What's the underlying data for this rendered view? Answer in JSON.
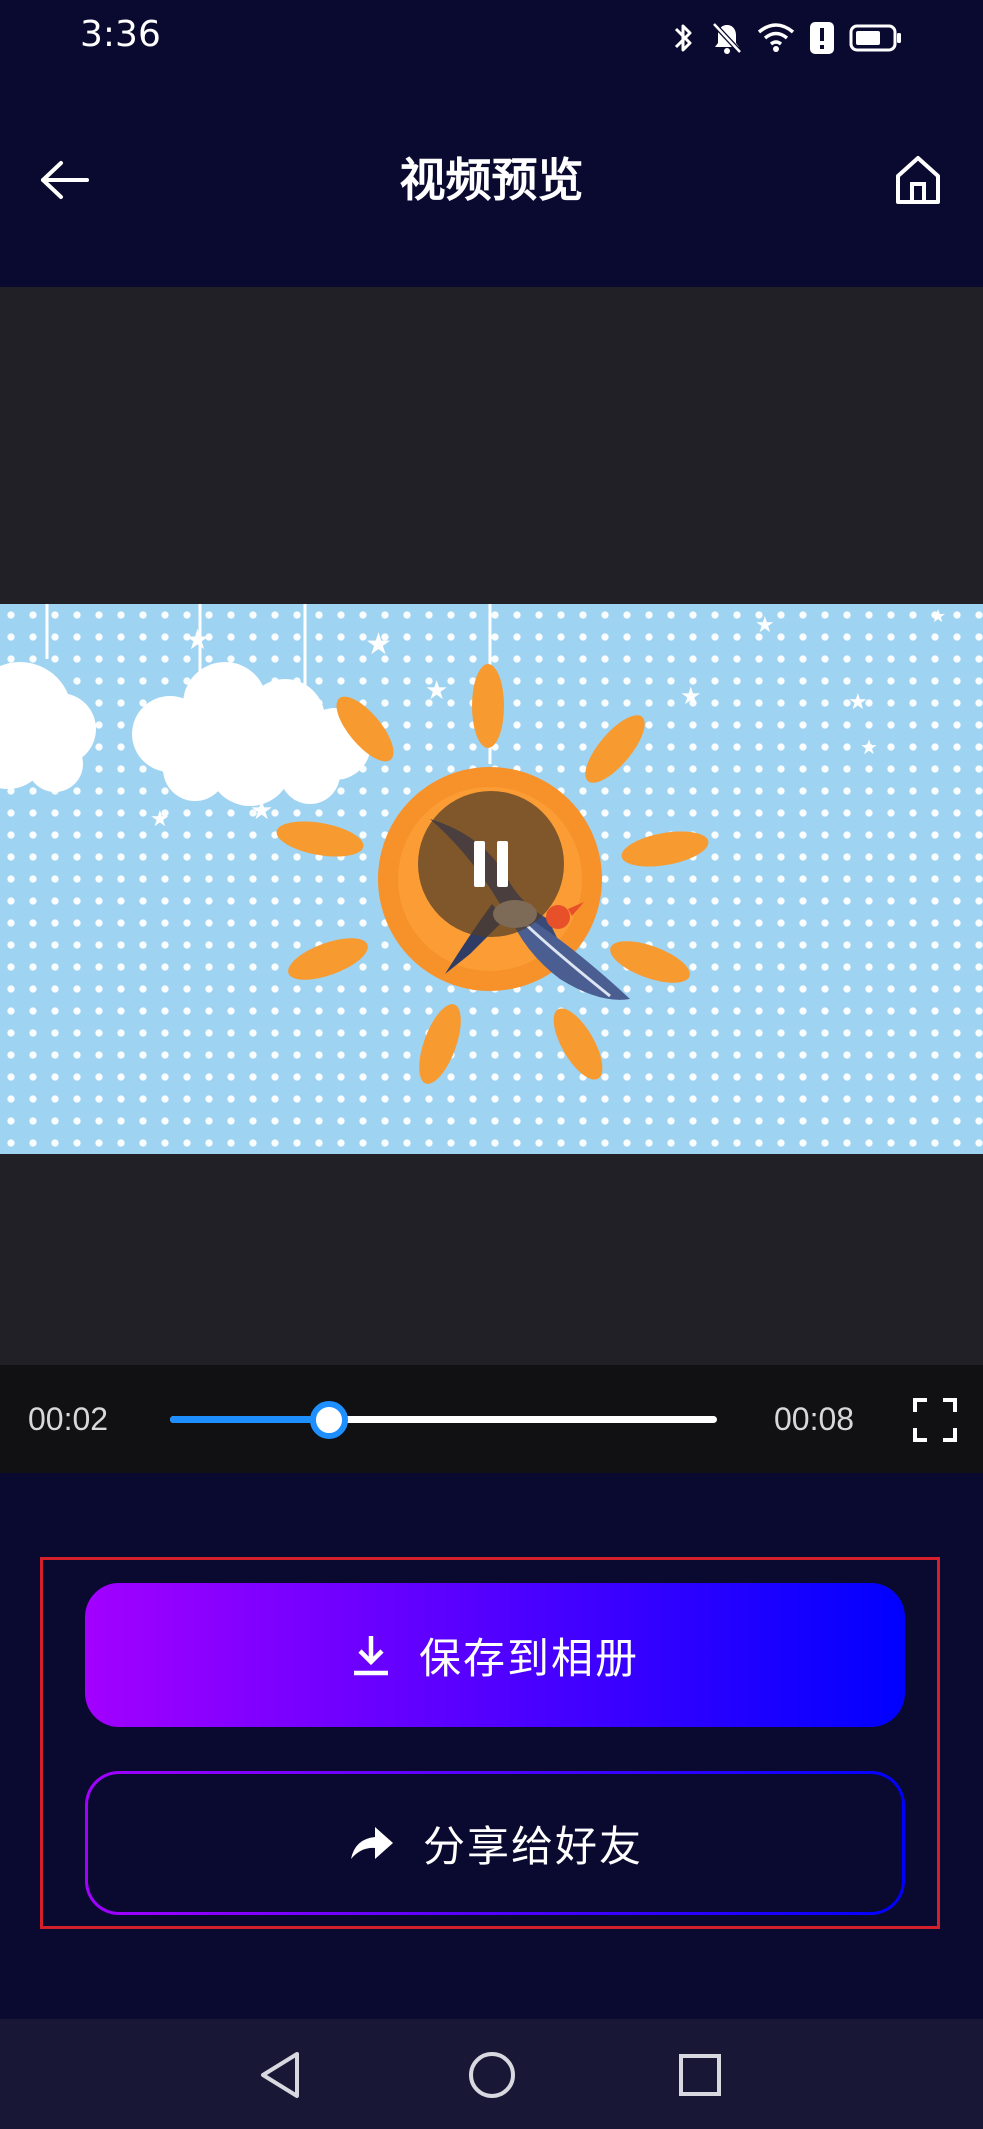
{
  "status_bar": {
    "time": "3:36",
    "icons": [
      "bluetooth-icon",
      "bell-muted-icon",
      "wifi-icon",
      "alert-icon",
      "battery-icon"
    ]
  },
  "header": {
    "title": "视频预览",
    "back_icon": "arrow-left-icon",
    "home_icon": "home-icon"
  },
  "player": {
    "current_time": "00:02",
    "total_time": "00:08",
    "progress_fraction": 0.29,
    "state_icon": "pause-icon",
    "fullscreen_icon": "fullscreen-icon",
    "progress_color": "#1e8fff"
  },
  "actions": {
    "save_label": "保存到相册",
    "save_icon": "download-icon",
    "share_label": "分享给好友",
    "share_icon": "share-arrow-icon",
    "gradient_start": "#a300ff",
    "gradient_end": "#0000ff",
    "highlight_border_color": "#d4202a"
  },
  "nav_bar": {
    "buttons": [
      "nav-back-icon",
      "nav-home-icon",
      "nav-recent-icon"
    ]
  }
}
